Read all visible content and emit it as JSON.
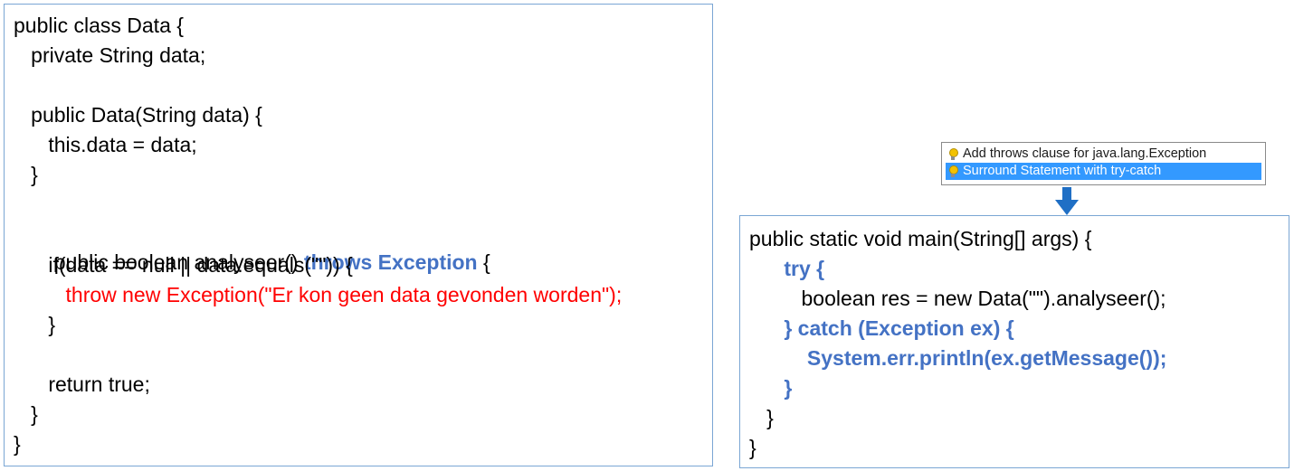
{
  "left_code": {
    "lines": [
      {
        "t": "public class Data {"
      },
      {
        "t": "   private String data;"
      },
      {
        "t": ""
      },
      {
        "t": "   public Data(String data) {"
      },
      {
        "t": "      this.data = data;"
      },
      {
        "t": "   }"
      },
      {
        "t": ""
      },
      {
        "t": "   public boolean analyseer() ",
        "kw": "throws Exception",
        "tail": " {"
      },
      {
        "t": "      if(data == null || data.equals(\"\")) {"
      },
      {
        "t": "         throw new Exception(\"Er kon geen data gevonden worden\");"
      },
      {
        "t": "      }"
      },
      {
        "t": ""
      },
      {
        "t": "      return true;"
      },
      {
        "t": "   }"
      },
      {
        "t": "}"
      }
    ]
  },
  "quickfix": {
    "items": [
      {
        "label": "Add throws clause for java.lang.Exception",
        "selected": false
      },
      {
        "label": "Surround Statement with try-catch",
        "selected": true
      }
    ]
  },
  "right_code": {
    "lines": [
      {
        "t": "public static void main(String[] args) {"
      },
      {
        "t": "      try {"
      },
      {
        "t": "         boolean res = new Data(\"\").analyseer();"
      },
      {
        "t": "      } catch (Exception ex) {"
      },
      {
        "t": "          System.err.println(ex.getMessage());"
      },
      {
        "t": "      }"
      },
      {
        "t": "   }"
      },
      {
        "t": "}"
      }
    ]
  },
  "colors": {
    "keyword_blue": "#4472c4",
    "error_red": "#ff0000",
    "selection_blue": "#3399ff",
    "box_border": "#7aa6d4",
    "arrow_blue": "#1f6fc5"
  }
}
